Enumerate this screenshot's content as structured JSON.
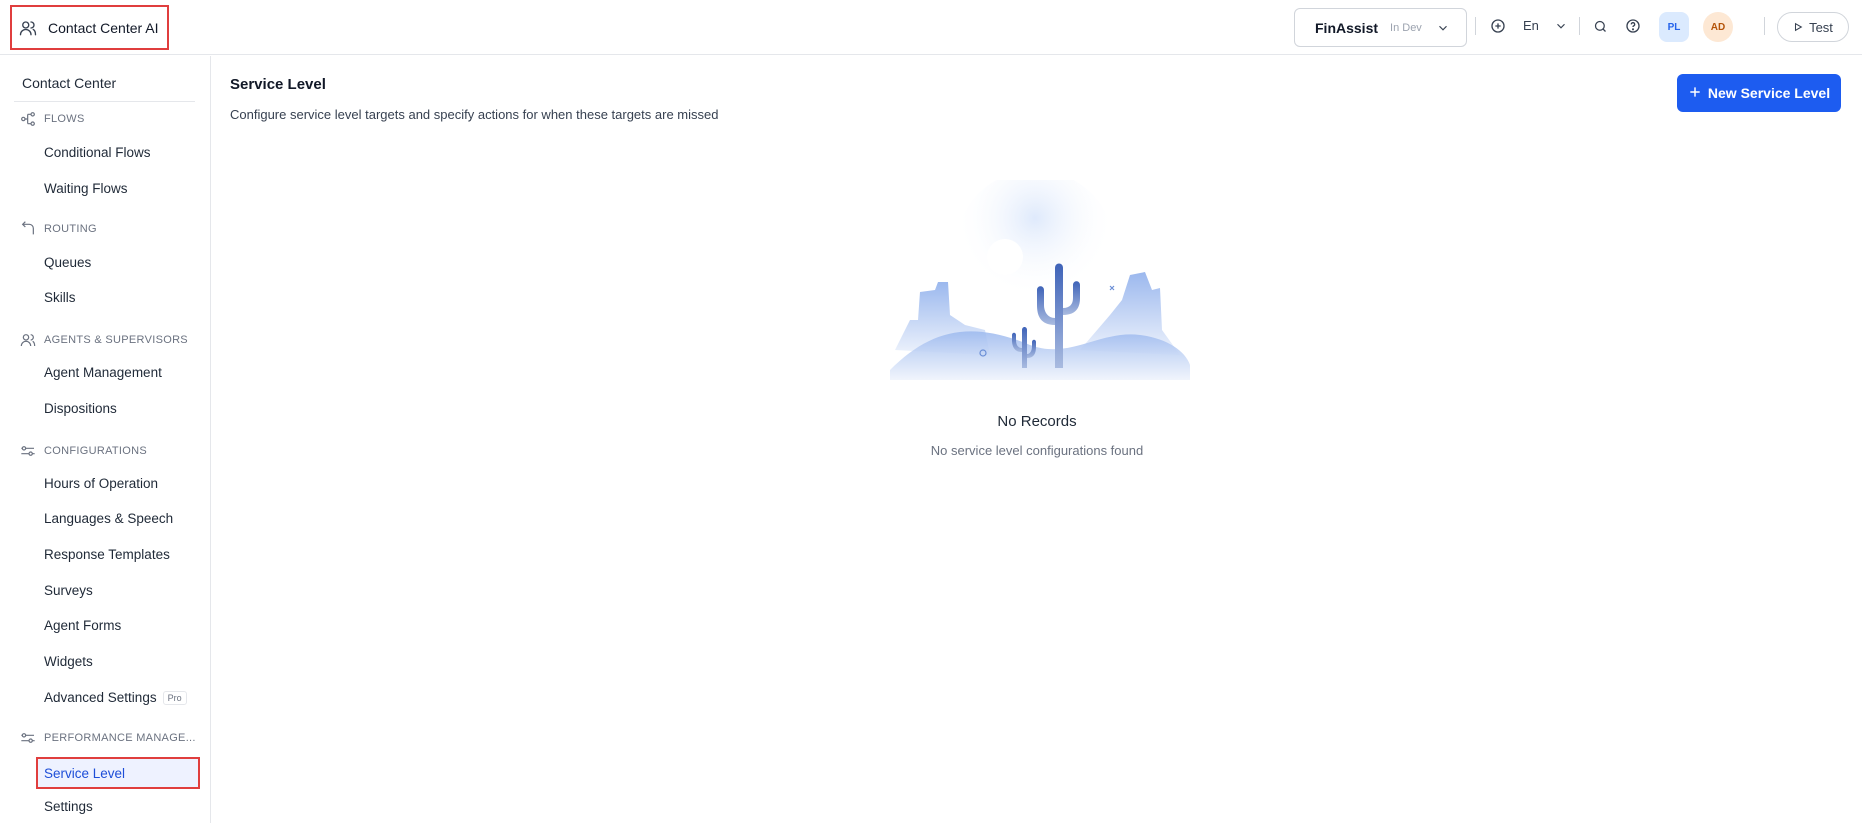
{
  "app": {
    "title": "Contact Center AI",
    "icon": "users-icon"
  },
  "topbar": {
    "workspace_name": "FinAssist",
    "workspace_env": "In Dev",
    "language": "En",
    "avatar_pl": "PL",
    "avatar_ad": "AD",
    "test_label": "Test"
  },
  "sidebar": {
    "header": "Contact Center",
    "sections": {
      "flows": "FLOWS",
      "routing": "ROUTING",
      "agents": "AGENTS & SUPERVISORS",
      "configurations": "CONFIGURATIONS",
      "performance": "PERFORMANCE MANAGE..."
    },
    "items": {
      "conditional_flows": "Conditional Flows",
      "waiting_flows": "Waiting Flows",
      "queues": "Queues",
      "skills": "Skills",
      "agent_management": "Agent Management",
      "dispositions": "Dispositions",
      "hours_of_operation": "Hours of Operation",
      "languages_speech": "Languages & Speech",
      "response_templates": "Response Templates",
      "surveys": "Surveys",
      "agent_forms": "Agent Forms",
      "widgets": "Widgets",
      "advanced_settings": "Advanced Settings",
      "advanced_settings_badge": "Pro",
      "service_level": "Service Level",
      "settings": "Settings"
    }
  },
  "main": {
    "title": "Service Level",
    "description": "Configure service level targets and specify actions for when these targets are missed",
    "new_button": "New Service Level",
    "empty_title": "No Records",
    "empty_subtitle": "No service level configurations found"
  },
  "colors": {
    "accent": "#1d5cf0",
    "highlight_border": "#e03e3e",
    "active_text": "#1d4ed8"
  }
}
